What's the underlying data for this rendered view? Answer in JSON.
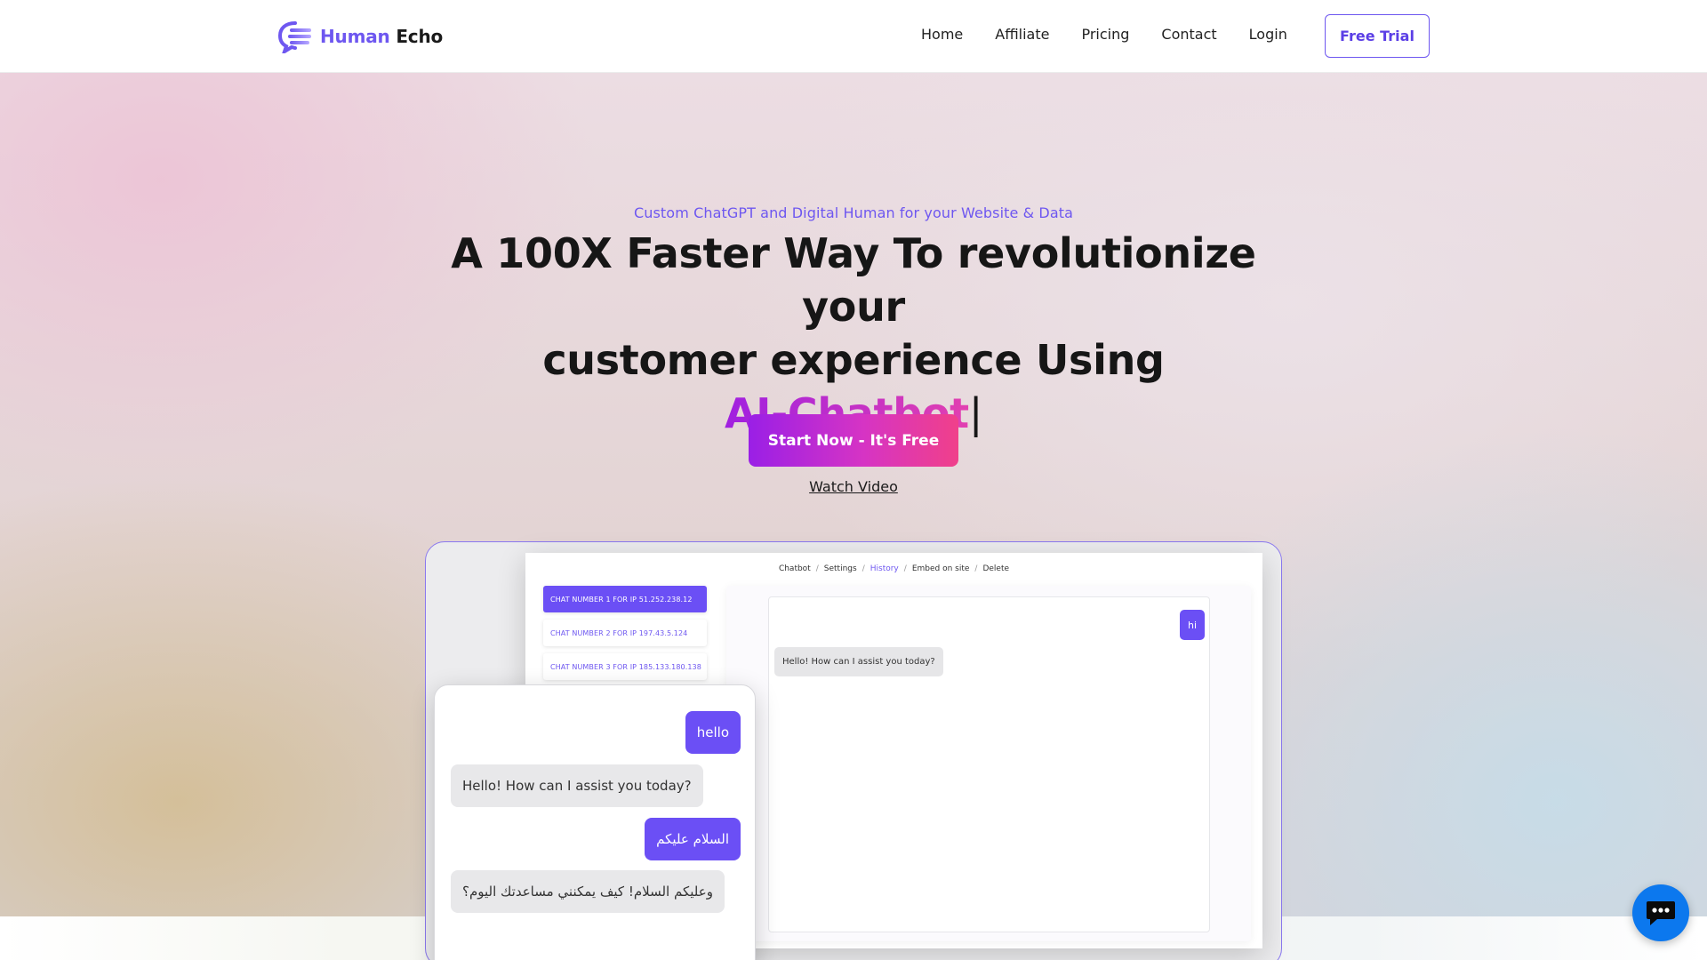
{
  "brand": {
    "name_part1": "Human",
    "name_part2": "Echo"
  },
  "nav": {
    "links": [
      "Home",
      "Affiliate",
      "Pricing",
      "Contact",
      "Login"
    ],
    "cta": "Free Trial"
  },
  "hero": {
    "eyebrow": "Custom ChatGPT and Digital Human for your Website & Data",
    "headline_line1": "A 100X Faster Way To revolutionize your",
    "headline_line2": "customer experience Using",
    "headline_accent": "AI-Chatbot",
    "cursor": "|",
    "primary_cta": "Start Now - It's Free",
    "secondary_cta": "Watch Video"
  },
  "preview": {
    "breadcrumb": [
      "Chatbot",
      "Settings",
      "History",
      "Embed on site",
      "Delete"
    ],
    "breadcrumb_active": "History",
    "chat_list": [
      "CHAT NUMBER 1 FOR IP 51.252.238.12",
      "CHAT NUMBER 2 FOR IP 197.43.5.124",
      "CHAT NUMBER 3 FOR IP 185.133.180.138"
    ],
    "history": {
      "user": "hi",
      "bot": "Hello! How can I assist you today?"
    },
    "mobile": {
      "user1": "hello",
      "bot1": "Hello! How can I assist you today?",
      "user2": "السلام عليكم",
      "bot2": "وعليكم السلام! كيف يمكنني مساعدتك اليوم؟"
    }
  },
  "colors": {
    "brand_purple": "#6e57f0",
    "cta_gradient_start": "#9a1fe6",
    "cta_gradient_end": "#f0408a",
    "chat_widget": "#0c78ee"
  },
  "icons": {
    "brand_logo": "brand-logo-icon",
    "chat_widget": "chat-bubble-icon"
  }
}
